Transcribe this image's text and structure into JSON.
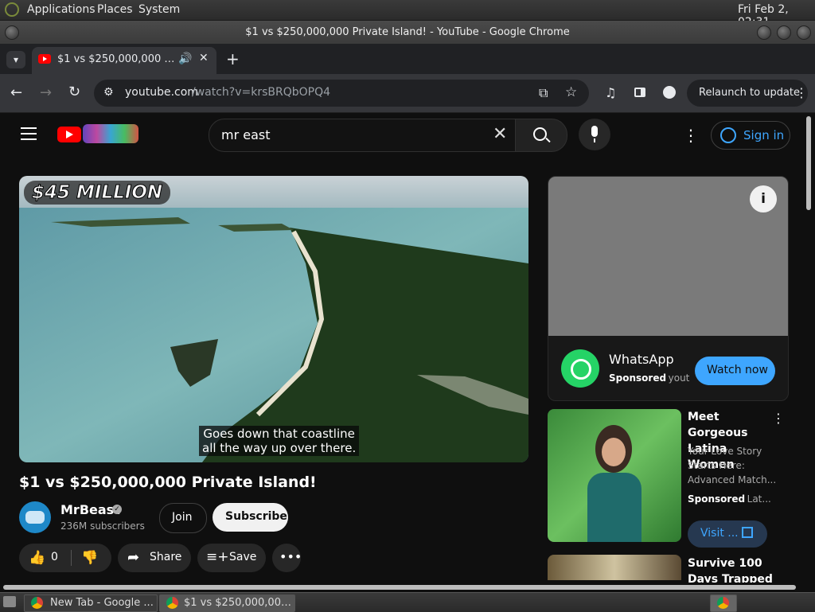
{
  "system_panel": {
    "menus": [
      "Applications",
      "Places",
      "System"
    ],
    "clock": "Fri Feb  2, 02:31"
  },
  "window": {
    "title": "$1 vs $250,000,000 Private Island! - YouTube - Google Chrome"
  },
  "browser": {
    "tab_title": "$1 vs $250,000,000 Private Island!",
    "new_tab_label": "+",
    "url_domain": "youtube.com",
    "url_path": "/watch?v=krsBRQbOPQ4",
    "relaunch_label": "Relaunch to update"
  },
  "youtube": {
    "search_value": "mr east",
    "sign_in_label": "Sign in",
    "video": {
      "overlay_title": "$45 MILLION",
      "caption_line1": "Goes down that coastline",
      "caption_line2": "all the way up over there.",
      "title": "$1 vs $250,000,000 Private Island!"
    },
    "channel": {
      "name": "MrBeast",
      "subscribers": "236M subscribers",
      "join_label": "Join",
      "subscribe_label": "Subscribe"
    },
    "actions": {
      "like_count": "0",
      "share_label": "Share",
      "save_label": "Save"
    },
    "ad": {
      "app_name": "WhatsApp",
      "sponsored": "Sponsored",
      "domain_hint": "· yout",
      "cta": "Watch now"
    },
    "ad2": {
      "title": "Meet Gorgeous Latina Women",
      "desc1": "Your Love Story",
      "desc2": "Starts Here:",
      "desc3": "Advanced Match...",
      "sponsored": "Sponsored",
      "domain_hint": "· Lat...",
      "cta": "Visit ..."
    },
    "rec": {
      "title_line1": "Survive 100",
      "title_line2": "Days Trapped"
    }
  },
  "taskbar": {
    "items": [
      "New Tab - Google ...",
      "$1 vs $250,000,000 ..."
    ]
  },
  "colors": {
    "yt_red": "#ff0000",
    "link_blue": "#3ea6ff",
    "whatsapp_green": "#25d366"
  }
}
